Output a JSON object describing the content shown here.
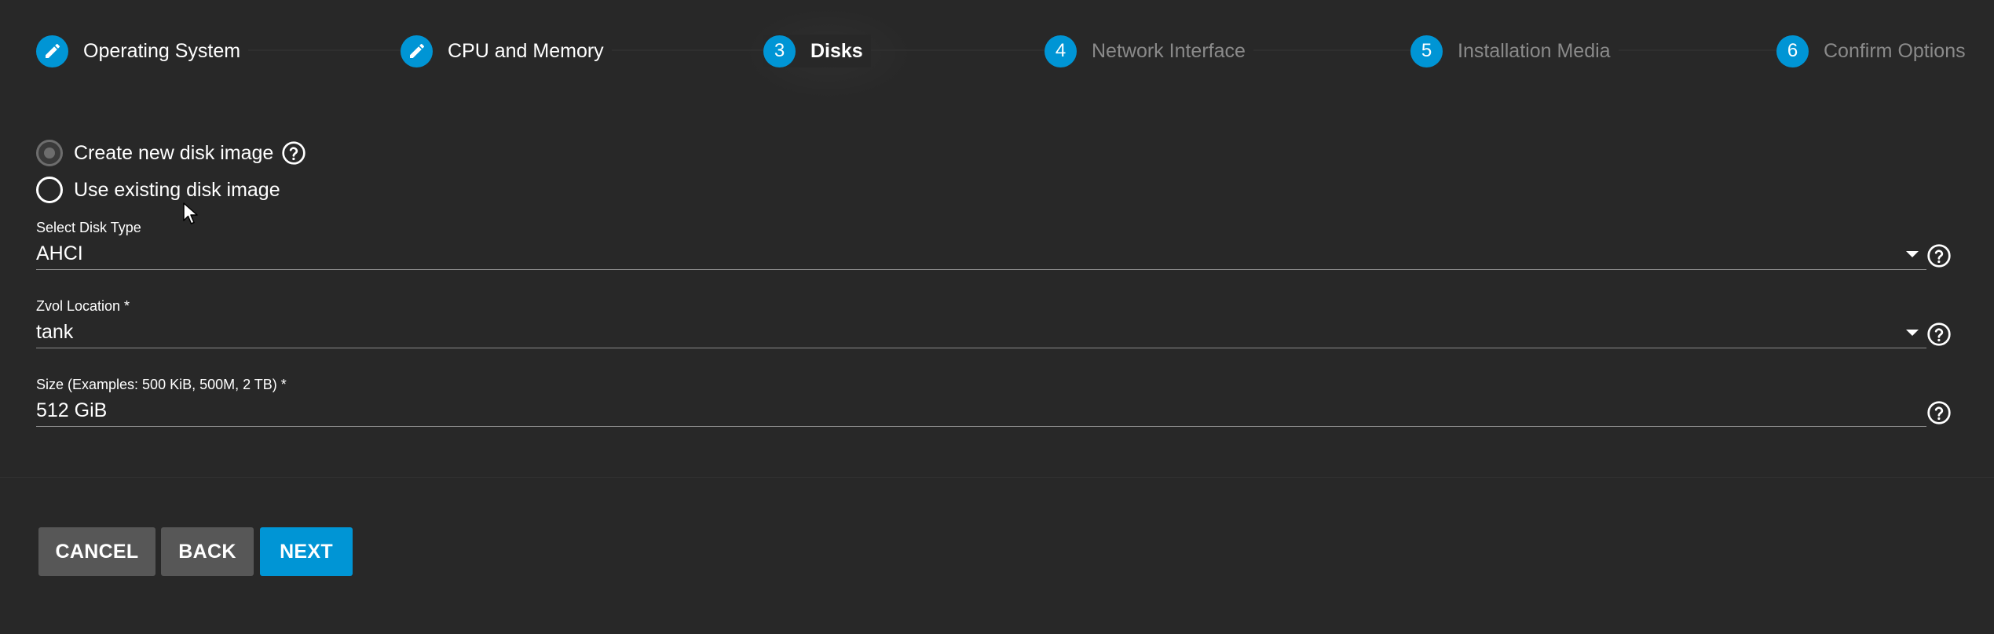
{
  "stepper": {
    "steps": [
      {
        "label": "Operating System",
        "number": "",
        "state": "completed",
        "icon": "pencil-icon"
      },
      {
        "label": "CPU and Memory",
        "number": "",
        "state": "completed",
        "icon": "pencil-icon"
      },
      {
        "label": "Disks",
        "number": "3",
        "state": "active",
        "icon": ""
      },
      {
        "label": "Network Interface",
        "number": "4",
        "state": "future",
        "icon": ""
      },
      {
        "label": "Installation Media",
        "number": "5",
        "state": "future",
        "icon": ""
      },
      {
        "label": "Confirm Options",
        "number": "6",
        "state": "future",
        "icon": ""
      }
    ]
  },
  "disk_options": {
    "create_new": {
      "label": "Create new disk image",
      "selected": true,
      "help_icon": "help-circle-icon"
    },
    "use_existing": {
      "label": "Use existing disk image",
      "selected": false
    }
  },
  "form": {
    "disk_type": {
      "label": "Select Disk Type",
      "value": "AHCI",
      "icon": "dropdown-caret-icon"
    },
    "zvol_location": {
      "label": "Zvol Location *",
      "value": "tank",
      "icon": "dropdown-caret-icon"
    },
    "size": {
      "label": "Size (Examples: 500 KiB, 500M, 2 TB) *",
      "value": "512 GiB"
    }
  },
  "actions": {
    "cancel_label": "CANCEL",
    "back_label": "BACK",
    "next_label": "NEXT"
  },
  "colors": {
    "background": "#282828",
    "accent": "#0095d5",
    "secondary_button": "#575757",
    "muted_text": "#8a8a8a"
  }
}
